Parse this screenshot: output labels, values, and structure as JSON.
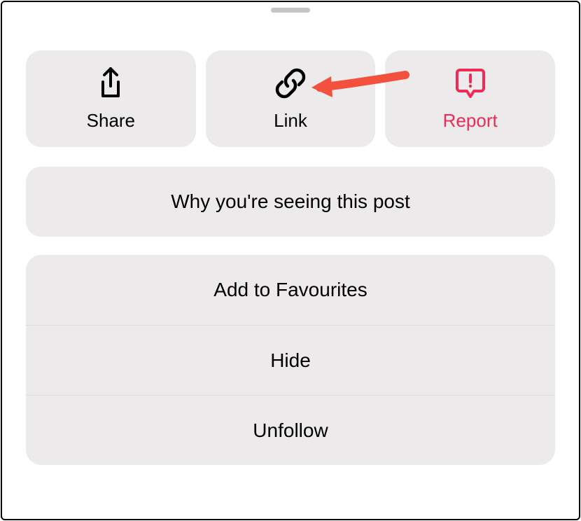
{
  "tiles": {
    "share": {
      "label": "Share"
    },
    "link": {
      "label": "Link"
    },
    "report": {
      "label": "Report"
    }
  },
  "explain": {
    "label": "Why you're seeing this post"
  },
  "list": {
    "favourites": {
      "label": "Add to Favourites"
    },
    "hide": {
      "label": "Hide"
    },
    "unfollow": {
      "label": "Unfollow"
    }
  },
  "colors": {
    "danger": "#ee2b55",
    "arrow": "#f3503e",
    "tile_bg": "#eceaeb"
  }
}
